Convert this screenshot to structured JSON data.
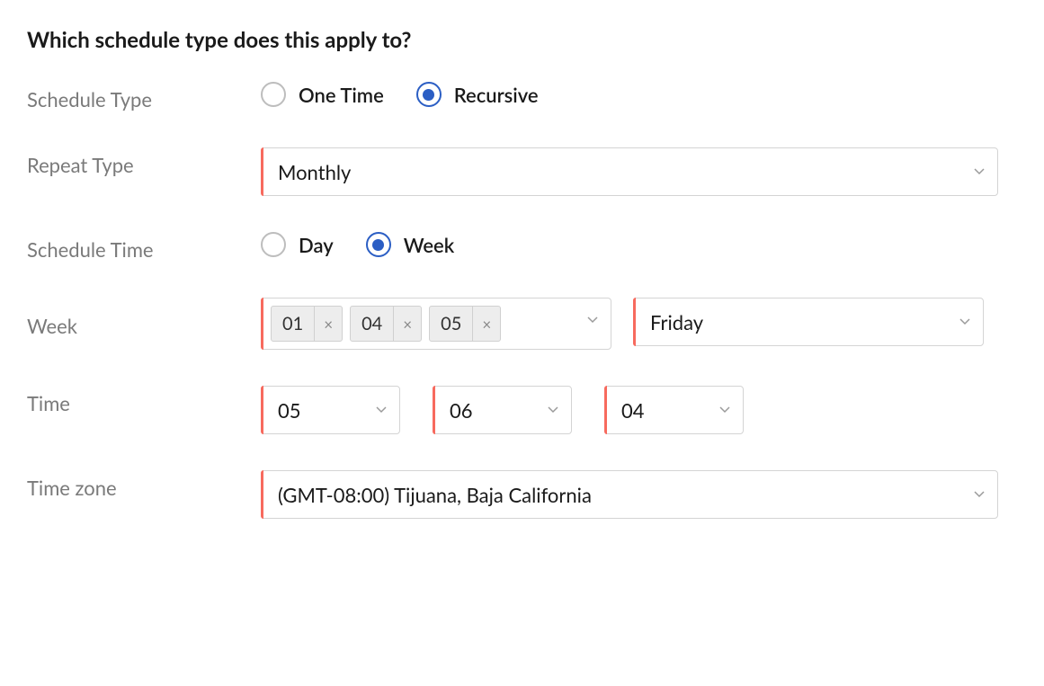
{
  "heading": "Which schedule type does this apply to?",
  "labels": {
    "schedule_type": "Schedule Type",
    "repeat_type": "Repeat Type",
    "schedule_time": "Schedule Time",
    "week": "Week",
    "time": "Time",
    "time_zone": "Time zone"
  },
  "schedule_type": {
    "options": {
      "one_time": "One Time",
      "recursive": "Recursive"
    },
    "selected": "recursive"
  },
  "repeat_type": {
    "value": "Monthly"
  },
  "schedule_time": {
    "options": {
      "day": "Day",
      "week": "Week"
    },
    "selected": "week"
  },
  "week": {
    "tags": [
      "01",
      "04",
      "05"
    ],
    "day": "Friday"
  },
  "time": {
    "h": "05",
    "m": "06",
    "s": "04"
  },
  "time_zone": {
    "value": "(GMT-08:00) Tijuana, Baja California"
  }
}
